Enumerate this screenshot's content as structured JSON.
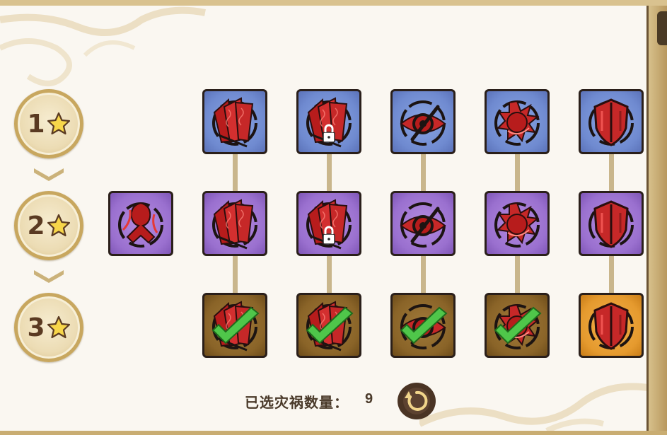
{
  "levels": [
    {
      "number": "1",
      "star_icon": "star-icon"
    },
    {
      "number": "2",
      "star_icon": "star-icon"
    },
    {
      "number": "3",
      "star_icon": "star-icon"
    }
  ],
  "tiles": {
    "row1": [
      {
        "icon": "red-cards-icon",
        "tier": "blue"
      },
      {
        "icon": "red-cards-locked-icon",
        "tier": "blue",
        "locked": true
      },
      {
        "icon": "crossed-eye-icon",
        "tier": "blue"
      },
      {
        "icon": "spiked-orb-icon",
        "tier": "blue"
      },
      {
        "icon": "red-shield-icon",
        "tier": "blue"
      }
    ],
    "row2": [
      {
        "icon": "burning-figure-icon",
        "tier": "purple"
      },
      {
        "icon": "red-cards-icon",
        "tier": "purple"
      },
      {
        "icon": "red-cards-locked-icon",
        "tier": "purple",
        "locked": true
      },
      {
        "icon": "crossed-eye-icon",
        "tier": "purple"
      },
      {
        "icon": "spiked-orb-icon",
        "tier": "purple"
      },
      {
        "icon": "red-shield-icon",
        "tier": "purple"
      }
    ],
    "row3": [
      {
        "icon": "red-cards-icon",
        "tier": "brown",
        "selected": true
      },
      {
        "icon": "red-cards-icon",
        "tier": "brown",
        "selected": true
      },
      {
        "icon": "crossed-eye-icon",
        "tier": "brown",
        "selected": true
      },
      {
        "icon": "spiked-orb-icon",
        "tier": "brown",
        "selected": true
      },
      {
        "icon": "red-shield-icon",
        "tier": "orange",
        "selected": false
      }
    ]
  },
  "counter": {
    "label": "已选灾祸数量：",
    "value": "9"
  },
  "reset_button": {
    "icon": "reset-arrow-icon"
  },
  "colors": {
    "tier_blue": "#6f8ad0",
    "tier_purple": "#9a70cf",
    "tier_brown": "#8a6428",
    "tier_orange": "#e59a2e",
    "check_green": "#4fc64a",
    "icon_red": "#c62828"
  }
}
